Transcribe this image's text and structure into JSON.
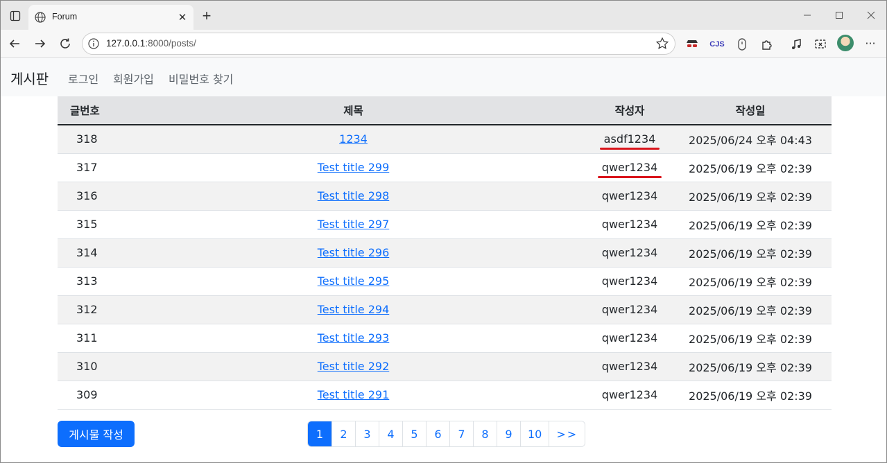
{
  "browser": {
    "tab_title": "Forum",
    "url_host": "127.0.0.1",
    "url_rest": ":8000/posts/",
    "extensions": [
      "incognito-ext-icon",
      "cjs-ext-icon",
      "shield-ext-icon",
      "puzzle-icon",
      "music-icon",
      "screenshot-icon"
    ],
    "cjs_label": "CJS"
  },
  "navbar": {
    "brand": "게시판",
    "links": [
      "로그인",
      "회원가입",
      "비밀번호 찾기"
    ]
  },
  "table": {
    "headers": [
      "글번호",
      "제목",
      "작성자",
      "작성일"
    ],
    "rows": [
      {
        "no": "318",
        "title": "1234",
        "author": "asdf1234",
        "date": "2025/06/24 오후 04:43"
      },
      {
        "no": "317",
        "title": "Test title 299",
        "author": "qwer1234",
        "date": "2025/06/19 오후 02:39"
      },
      {
        "no": "316",
        "title": "Test title 298",
        "author": "qwer1234",
        "date": "2025/06/19 오후 02:39"
      },
      {
        "no": "315",
        "title": "Test title 297",
        "author": "qwer1234",
        "date": "2025/06/19 오후 02:39"
      },
      {
        "no": "314",
        "title": "Test title 296",
        "author": "qwer1234",
        "date": "2025/06/19 오후 02:39"
      },
      {
        "no": "313",
        "title": "Test title 295",
        "author": "qwer1234",
        "date": "2025/06/19 오후 02:39"
      },
      {
        "no": "312",
        "title": "Test title 294",
        "author": "qwer1234",
        "date": "2025/06/19 오후 02:39"
      },
      {
        "no": "311",
        "title": "Test title 293",
        "author": "qwer1234",
        "date": "2025/06/19 오후 02:39"
      },
      {
        "no": "310",
        "title": "Test title 292",
        "author": "qwer1234",
        "date": "2025/06/19 오후 02:39"
      },
      {
        "no": "309",
        "title": "Test title 291",
        "author": "qwer1234",
        "date": "2025/06/19 오후 02:39"
      }
    ]
  },
  "write_button": "게시물 작성",
  "pagination": {
    "pages": [
      "1",
      "2",
      "3",
      "4",
      "5",
      "6",
      "7",
      "8",
      "9",
      "10"
    ],
    "next": ">>",
    "active": "1"
  },
  "colors": {
    "primary": "#0d6efd",
    "annotation_underline": "#d9141b"
  }
}
